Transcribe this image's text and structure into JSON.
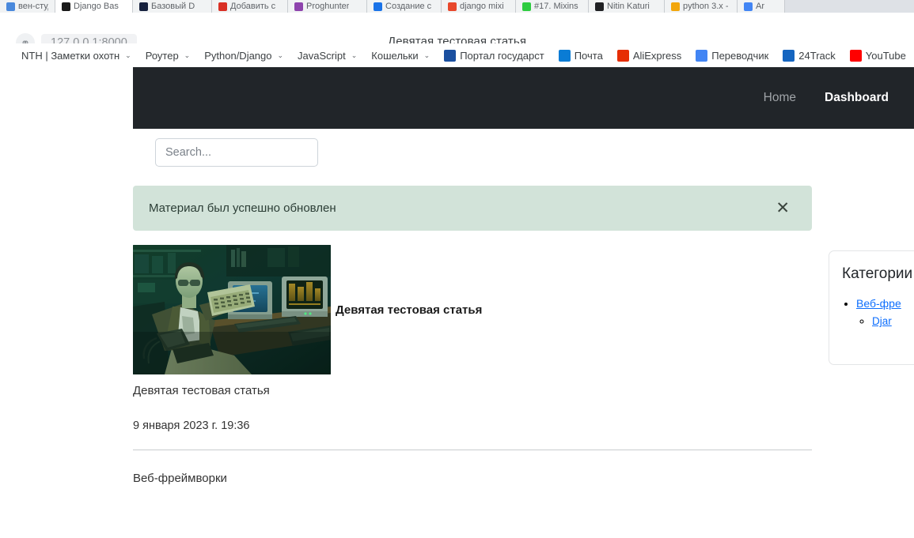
{
  "browser": {
    "url": "127.0.0.1:8000",
    "page_title": "Девятая тестовая статья",
    "globe_icon": "globe-icon",
    "tabs": [
      {
        "label": "вен-студи",
        "color": "#4a89dc"
      },
      {
        "label": "Django Bas",
        "color": "#1a1a1a"
      },
      {
        "label": "Базовый D",
        "color": "#16213e"
      },
      {
        "label": "Добавить с",
        "color": "#d93025"
      },
      {
        "label": "Proghunter",
        "color": "#8e44ad"
      },
      {
        "label": "Создание с",
        "color": "#1a73e8"
      },
      {
        "label": "django mixi",
        "color": "#e8482c"
      },
      {
        "label": "#17. Mixins",
        "color": "#2ecc40"
      },
      {
        "label": "Nitin Katuri",
        "color": "#202124"
      },
      {
        "label": "python 3.x -",
        "color": "#f2a60c"
      },
      {
        "label": "Ar",
        "color": "#4285f4"
      }
    ],
    "bookmarks": [
      {
        "label": "NTH | Заметки охотн",
        "has_chevron": true,
        "icon": null,
        "icon_name": "folder-icon"
      },
      {
        "label": "Роутер",
        "has_chevron": true,
        "icon": null,
        "icon_name": "folder-icon"
      },
      {
        "label": "Python/Django",
        "has_chevron": true,
        "icon": null,
        "icon_name": "folder-icon"
      },
      {
        "label": "JavaScript",
        "has_chevron": true,
        "icon": null,
        "icon_name": "folder-icon"
      },
      {
        "label": "Кошельки",
        "has_chevron": true,
        "icon": null,
        "icon_name": "folder-icon"
      },
      {
        "label": "Портал государст",
        "has_chevron": false,
        "icon": "#1a4fa0",
        "icon_name": "gosuslugi-icon"
      },
      {
        "label": "Почта",
        "has_chevron": false,
        "icon": "#0a7cd5",
        "icon_name": "mail-icon"
      },
      {
        "label": "AliExpress",
        "has_chevron": false,
        "icon": "#e62e04",
        "icon_name": "aliexpress-icon"
      },
      {
        "label": "Переводчик",
        "has_chevron": false,
        "icon": "#4285f4",
        "icon_name": "translate-icon"
      },
      {
        "label": "24Track",
        "has_chevron": false,
        "icon": "#1565c0",
        "icon_name": "24track-icon"
      },
      {
        "label": "YouTube",
        "has_chevron": false,
        "icon": "#ff0000",
        "icon_name": "youtube-icon"
      },
      {
        "label": "",
        "has_chevron": false,
        "icon": "#f4772b",
        "icon_name": "flame-icon"
      }
    ]
  },
  "navbar": {
    "home_label": "Home",
    "dashboard_label": "Dashboard",
    "background_color": "#212529"
  },
  "search": {
    "placeholder": "Search...",
    "value": ""
  },
  "alert": {
    "message": "Материал был успешно обновлен",
    "close_label": "✕",
    "background_color": "#d2e3d9"
  },
  "article": {
    "title": "Девятая тестовая статья",
    "caption": "Девятая тестовая статья",
    "date": "9 января 2023 г. 19:36",
    "category": "Веб-фреймворки",
    "image_alt": "Человек за ретро-компьютером"
  },
  "sidebar": {
    "title": "Категории",
    "items": [
      {
        "label": "Веб-фре",
        "full_label": "Веб-фреймворки",
        "level": 0
      },
      {
        "label": "Djar",
        "full_label": "Django",
        "level": 1
      }
    ],
    "link_color": "#0d6efd"
  }
}
